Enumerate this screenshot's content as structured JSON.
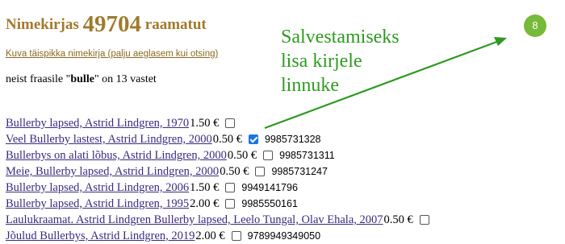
{
  "header": {
    "title_prefix": "Nimekirjas",
    "count": "49704",
    "title_suffix": "raamatut",
    "full_list_link": "Kuva täispikka nimekirja (palju aeglasem kui otsing)",
    "summary_prefix": "neist fraasile \"",
    "query": "bulle",
    "summary_suffix": "\" on 13 vastet"
  },
  "hint": {
    "line1": "Salvestamiseks",
    "line2": "lisa kirjele",
    "line3": "linnuke"
  },
  "badge": {
    "value": "8",
    "color": "#77b93a"
  },
  "colors": {
    "title": "#a07a2c",
    "link": "#3b2a80",
    "hint": "#2e9a20",
    "checkbox_checked": "#1a73e8"
  },
  "results": [
    {
      "title": "Bullerby lapsed, Astrid Lindgren, 1970",
      "price": "1.50 €",
      "checked": false,
      "isbn": ""
    },
    {
      "title": "Veel Bullerby lastest, Astrid Lindgren, 2000",
      "price": "0.50 €",
      "checked": true,
      "isbn": "9985731328"
    },
    {
      "title": "Bullerbys on alati lõbus, Astrid Lindgren, 2000",
      "price": "0.50 €",
      "checked": false,
      "isbn": "9985731311"
    },
    {
      "title": "Meie, Bullerby lapsed, Astrid Lindgren, 2000",
      "price": "0.50 €",
      "checked": false,
      "isbn": "9985731247"
    },
    {
      "title": "Bullerby lapsed, Astrid Lindgren, 2006",
      "price": "1.50 €",
      "checked": false,
      "isbn": "9949141796"
    },
    {
      "title": "Bullerby lapsed, Astrid Lindgren, 1995",
      "price": "2.00 €",
      "checked": false,
      "isbn": "9985550161"
    },
    {
      "title": "Laulukraamat. Astrid Lindgren Bullerby lapsed, Leelo Tungal, Olav Ehala, 2007",
      "price": "0.50 €",
      "checked": false,
      "isbn": ""
    },
    {
      "title": "Jõulud Bullerbys, Astrid Lindgren, 2019",
      "price": "2.00 €",
      "checked": false,
      "isbn": "9789949349050"
    }
  ]
}
